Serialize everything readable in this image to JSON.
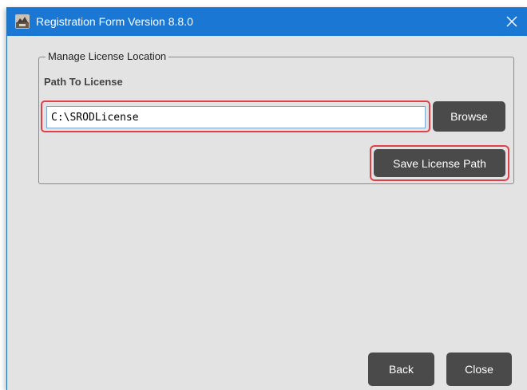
{
  "window": {
    "title": "Registration Form Version 8.8.0",
    "app_icon": "app-logo-icon",
    "close_glyph": "close-icon"
  },
  "group": {
    "legend": "Manage License Location",
    "path_label": "Path To License"
  },
  "path_input": {
    "value": "C:\\SRODLicense",
    "placeholder": ""
  },
  "buttons": {
    "browse": "Browse",
    "save_license_path": "Save License Path",
    "back": "Back",
    "close": "Close"
  },
  "colors": {
    "titlebar": "#1a78d4",
    "window_bg": "#e3e3e3",
    "button_bg": "#4a4a4a",
    "highlight": "#e0404a"
  }
}
